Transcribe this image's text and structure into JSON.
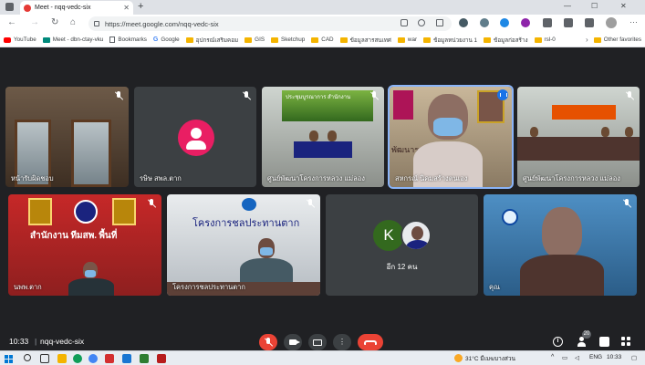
{
  "browser": {
    "tab_title": "Meet - nqq-vedc-six",
    "url": "https://meet.google.com/nqq-vedc-six",
    "bookmarks": [
      {
        "label": "YouTube",
        "icon": "youtube-icon"
      },
      {
        "label": "Meet - dbn-ctay-vku",
        "icon": "meet-icon"
      },
      {
        "label": "Bookmarks",
        "icon": "page-icon"
      },
      {
        "label": "Google",
        "icon": "google-icon"
      },
      {
        "label": "อุปกรณ์เสริมคอม",
        "icon": "folder-icon"
      },
      {
        "label": "GIS",
        "icon": "folder-icon"
      },
      {
        "label": "Sketchup",
        "icon": "folder-icon"
      },
      {
        "label": "CAD",
        "icon": "folder-icon"
      },
      {
        "label": "ข้อมูลสารสนเทศ",
        "icon": "folder-icon"
      },
      {
        "label": "war",
        "icon": "folder-icon"
      },
      {
        "label": "ข้อมูลหน่วยงาน 1",
        "icon": "folder-icon"
      },
      {
        "label": "ข้อมูลก่อสร้าง",
        "icon": "folder-icon"
      },
      {
        "label": "rsl-0",
        "icon": "folder-icon"
      }
    ],
    "other_favorites": "Other favorites"
  },
  "meet": {
    "tiles": [
      {
        "name": "หน้ารับผิดชอบ",
        "mic": "muted"
      },
      {
        "name": "รษิษ สพล.ตาก",
        "mic": "muted"
      },
      {
        "name": "ศูนย์พัฒนาโครงการหลวง แม่ลอง",
        "mic": "muted",
        "banner": "ประชุมบูรณาการ สำนักงาน"
      },
      {
        "name": "สหกรณ์ นิคมสร้างตนเอง",
        "mic": "speaking",
        "banner": "พัฒนาราษฎร์"
      },
      {
        "name": "ศูนย์พัฒนาโครงการหลวง แม่ลอง",
        "mic": "muted"
      },
      {
        "name": "นพพ.ตาก",
        "mic": "muted",
        "banner": "สำนักงาน ทีมสพ. พื้นที่"
      },
      {
        "name": "โครงการชลประทานตาก",
        "mic": "muted",
        "banner": "โครงการชลประทานตาก"
      },
      {
        "name": "คุณ",
        "mic": "muted"
      }
    ],
    "others": {
      "avatar_letter": "K",
      "label": "อีก 12 คน"
    },
    "bottom_bar": {
      "time": "10:33",
      "separator": "|",
      "meeting_code": "nqq-vedc-six",
      "people_count": "20"
    },
    "colors": {
      "end_call": "#ea4335",
      "mic_off": "#ea4335",
      "background": "#202124"
    }
  },
  "taskbar": {
    "weather": "31°C มีเมฆบางส่วน",
    "lang": "ENG",
    "clock": "10:33"
  }
}
